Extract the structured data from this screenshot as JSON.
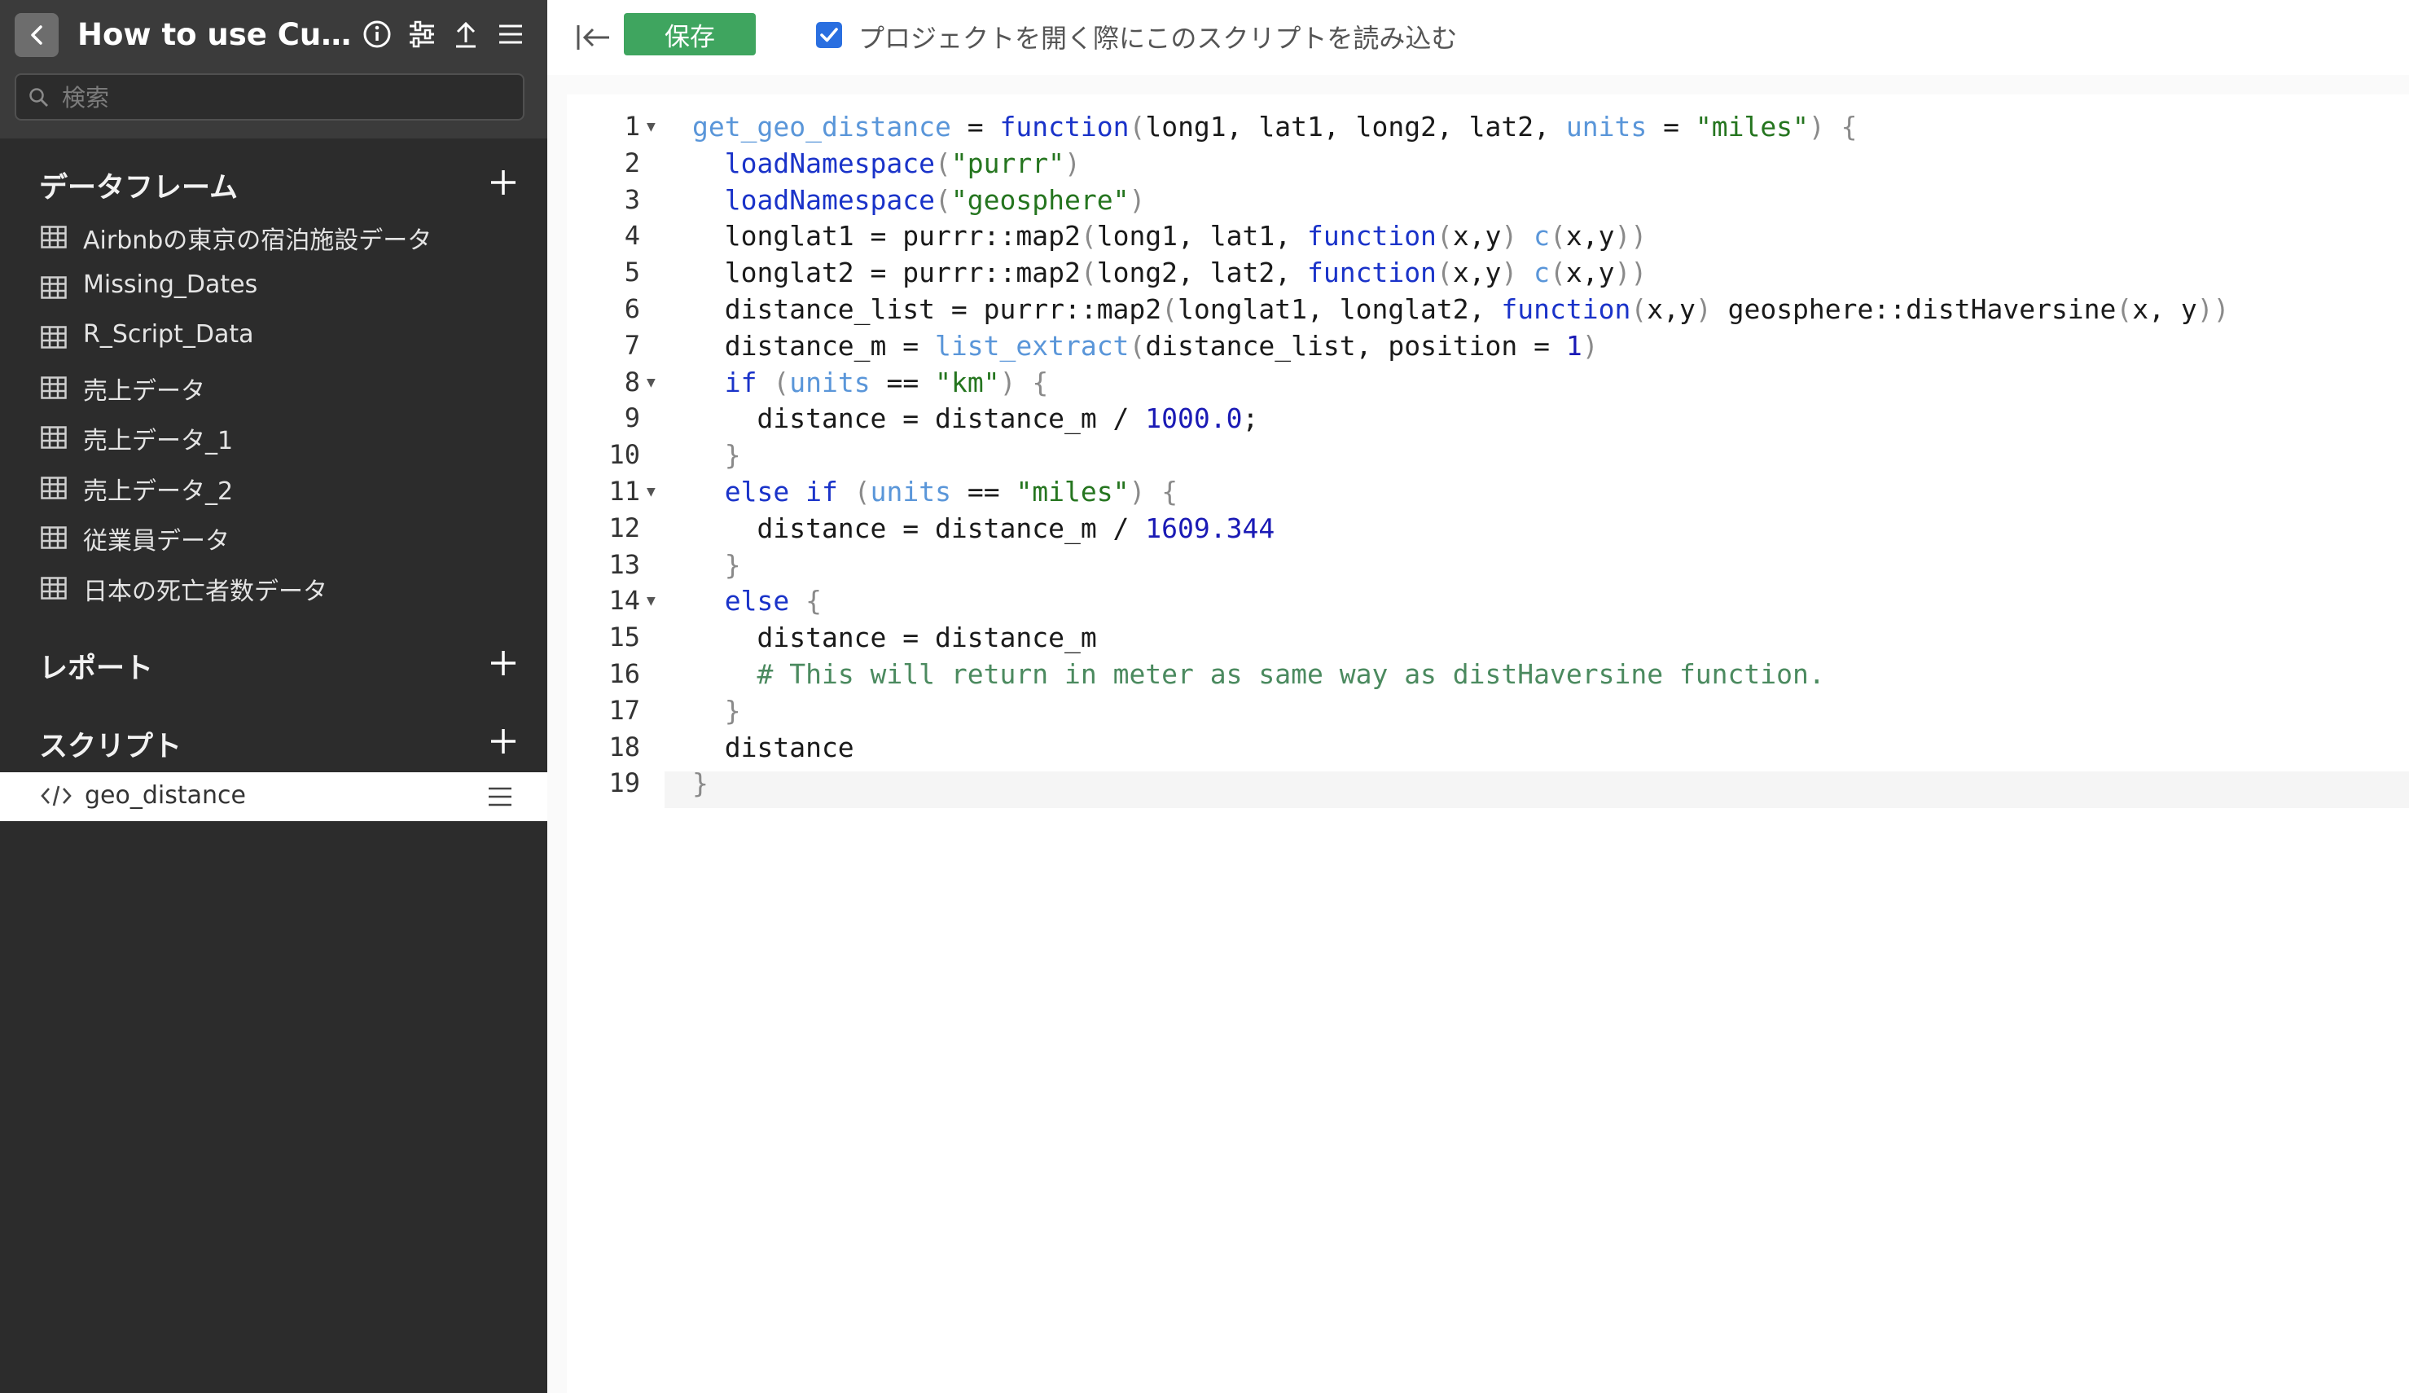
{
  "sidebar": {
    "project_title": "How to use Cust...",
    "search_placeholder": "検索",
    "sections": {
      "dataframes_title": "データフレーム",
      "reports_title": "レポート",
      "scripts_title": "スクリプト"
    },
    "dataframes": [
      "Airbnbの東京の宿泊施設データ",
      "Missing_Dates",
      "R_Script_Data",
      "売上データ",
      "売上データ_1",
      "売上データ_2",
      "従業員データ",
      "日本の死亡者数データ"
    ],
    "scripts": [
      "geo_distance"
    ]
  },
  "toolbar": {
    "save_label": "保存",
    "load_on_open_label": "プロジェクトを開く際にこのスクリプトを読み込む",
    "load_on_open_checked": true
  },
  "editor": {
    "current_line": 19,
    "line_numbers": [
      "1",
      "2",
      "3",
      "4",
      "5",
      "6",
      "7",
      "8",
      "9",
      "10",
      "11",
      "12",
      "13",
      "14",
      "15",
      "16",
      "17",
      "18",
      "19"
    ],
    "foldable_lines": [
      1,
      8,
      11,
      14
    ],
    "lines": [
      "get_geo_distance = function(long1, lat1, long2, lat2, units = \"miles\") {",
      "  loadNamespace(\"purrr\")",
      "  loadNamespace(\"geosphere\")",
      "  longlat1 = purrr::map2(long1, lat1, function(x,y) c(x,y))",
      "  longlat2 = purrr::map2(long2, lat2, function(x,y) c(x,y))",
      "  distance_list = purrr::map2(longlat1, longlat2, function(x,y) geosphere::distHaversine(x, y))",
      "  distance_m = list_extract(distance_list, position = 1)",
      "  if (units == \"km\") {",
      "    distance = distance_m / 1000.0;",
      "  }",
      "  else if (units == \"miles\") {",
      "    distance = distance_m / 1609.344",
      "  }",
      "  else {",
      "    distance = distance_m",
      "    # This will return in meter as same way as distHaversine function.",
      "  }",
      "  distance",
      "}"
    ]
  },
  "colors": {
    "sidebar_bg": "#2c2c2c",
    "save_button": "#3fa55f",
    "keyword": "#1a33c9",
    "string": "#25751f",
    "comment": "#4b8a5f"
  }
}
